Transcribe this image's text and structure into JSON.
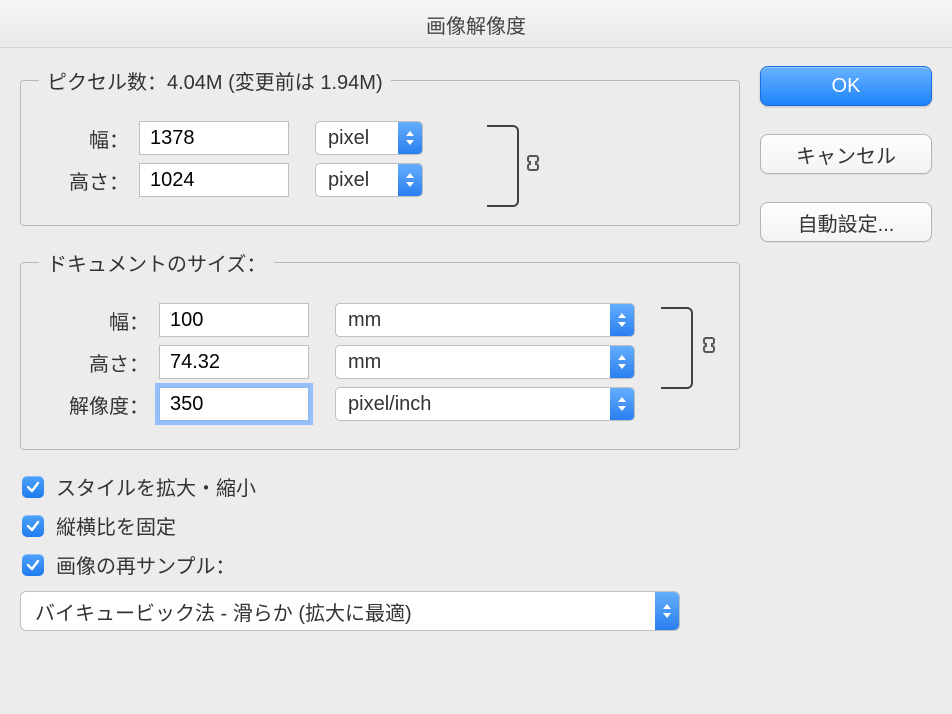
{
  "title": "画像解像度",
  "pixel_dimensions": {
    "legend": "ピクセル数：4.04M (変更前は 1.94M)",
    "width_label": "幅：",
    "width_value": "1378",
    "width_unit": "pixel",
    "height_label": "高さ：",
    "height_value": "1024",
    "height_unit": "pixel"
  },
  "document_size": {
    "legend": "ドキュメントのサイズ：",
    "width_label": "幅：",
    "width_value": "100",
    "width_unit": "mm",
    "height_label": "高さ：",
    "height_value": "74.32",
    "height_unit": "mm",
    "resolution_label": "解像度：",
    "resolution_value": "350",
    "resolution_unit": "pixel/inch"
  },
  "checkboxes": {
    "scale_styles": "スタイルを拡大・縮小",
    "constrain": "縦横比を固定",
    "resample": "画像の再サンプル："
  },
  "resample_method": "バイキュービック法 - 滑らか (拡大に最適)",
  "buttons": {
    "ok": "OK",
    "cancel": "キャンセル",
    "auto": "自動設定..."
  }
}
